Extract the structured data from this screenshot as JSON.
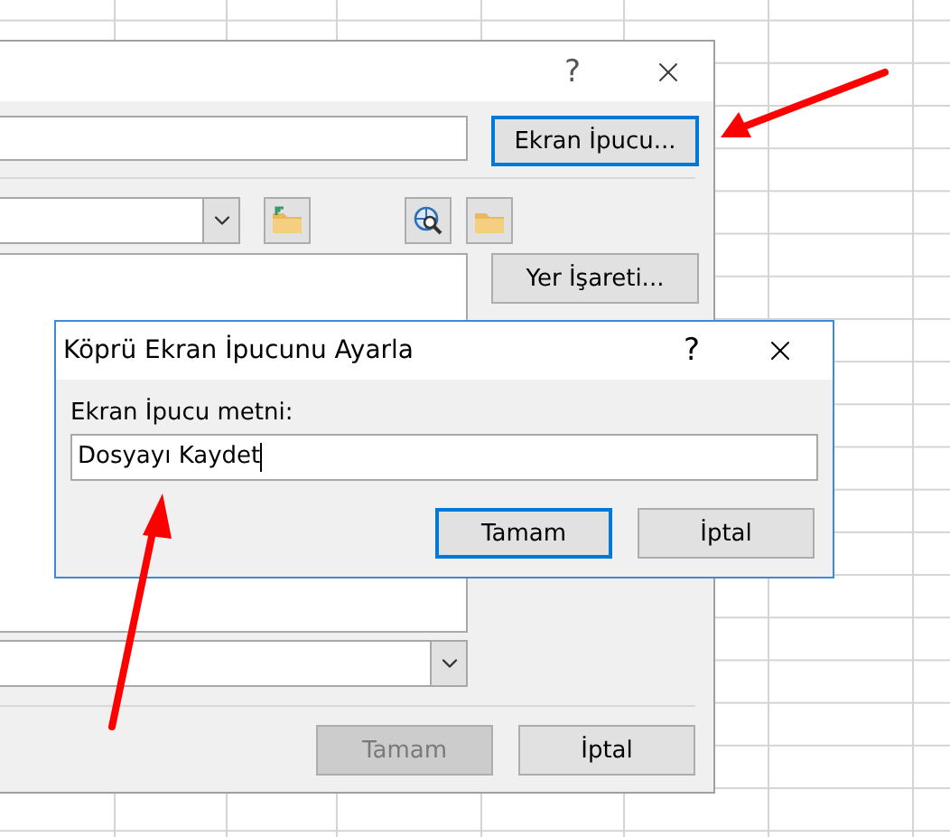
{
  "main_dialog": {
    "help": "?",
    "tooltip_button": {
      "label": "Ekran İpucu...",
      "default": true
    },
    "bookmark_button": {
      "label": "Yer İşareti...",
      "default": false
    },
    "buttons": [
      {
        "label": "Tamam",
        "disabled": true
      },
      {
        "label": "İptal",
        "disabled": false
      }
    ]
  },
  "tooltip_dialog": {
    "title": "Köprü Ekran İpucunu Ayarla",
    "help": "?",
    "field_label": "Ekran İpucu metni:",
    "value": "Dosyayı Kaydet",
    "buttons": [
      {
        "label": "Tamam",
        "default": true
      },
      {
        "label": "İptal",
        "default": false
      }
    ]
  }
}
